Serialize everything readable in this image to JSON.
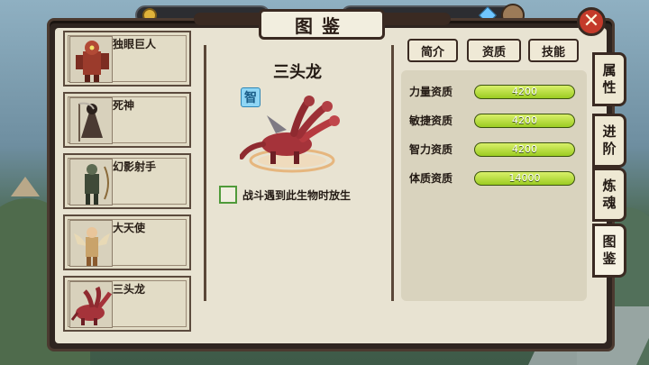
{
  "title": "图鉴",
  "close_label": "✕",
  "creatures": [
    {
      "name": "独眼巨人",
      "portrait_color": "#9b3b2c"
    },
    {
      "name": "死神",
      "portrait_color": "#4a3a32"
    },
    {
      "name": "幻影射手",
      "portrait_color": "#3f4a38"
    },
    {
      "name": "大天使",
      "portrait_color": "#c9a36a"
    },
    {
      "name": "三头龙",
      "portrait_color": "#a5333a"
    }
  ],
  "selected": {
    "name": "三头龙",
    "tag": "智",
    "release_text": "战斗遇到此生物时放生"
  },
  "top_tabs": [
    "简介",
    "资质",
    "技能"
  ],
  "stats": [
    {
      "label": "力量资质",
      "value": "4200",
      "fill_pct": 100
    },
    {
      "label": "敏捷资质",
      "value": "4200",
      "fill_pct": 100
    },
    {
      "label": "智力资质",
      "value": "4200",
      "fill_pct": 100
    },
    {
      "label": "体质资质",
      "value": "14000",
      "fill_pct": 100
    }
  ],
  "side_tabs": [
    {
      "label_top": "属",
      "label_bottom": "性"
    },
    {
      "label_top": "进",
      "label_bottom": "阶"
    },
    {
      "label_top": "炼",
      "label_bottom": "魂"
    },
    {
      "label_top": "图",
      "label_bottom": "鉴"
    }
  ],
  "colors": {
    "frame": "#2f2520",
    "panel": "#e8e3d2",
    "bar_fill": "#b4e036",
    "close": "#c43a2a"
  }
}
